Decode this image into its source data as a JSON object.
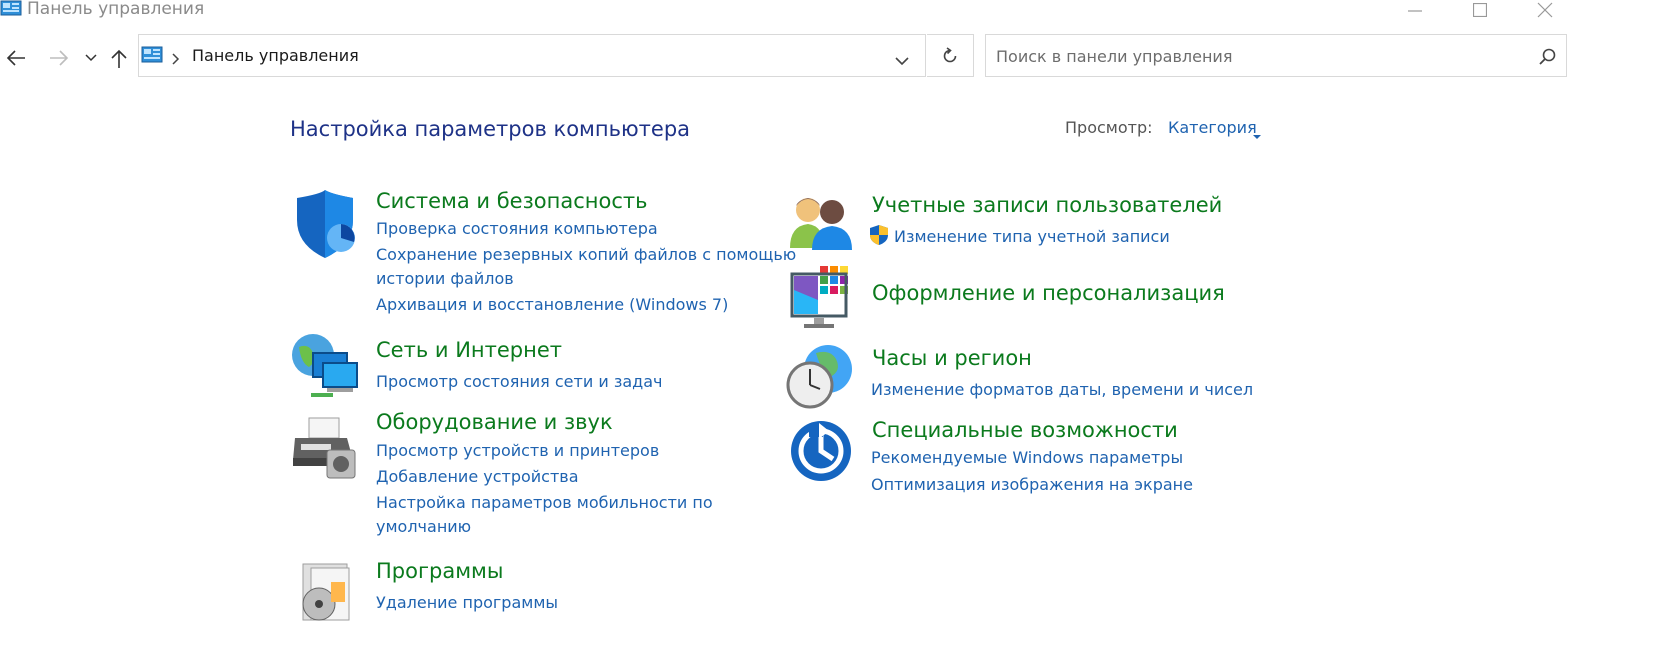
{
  "window": {
    "title": "Панель управления"
  },
  "address_bar": {
    "path_item": "Панель управления"
  },
  "search": {
    "placeholder": "Поиск в панели управления"
  },
  "main": {
    "heading": "Настройка параметров компьютера",
    "view_label": "Просмотр:",
    "view_value": "Категория"
  },
  "categories": [
    {
      "title": "Система и безопасность",
      "icon": "shield-icon",
      "links": [
        "Проверка состояния компьютера",
        "Сохранение резервных копий файлов с помощью",
        "истории файлов",
        "Архивация и восстановление (Windows 7)"
      ]
    },
    {
      "title": "Сеть и Интернет",
      "icon": "network-icon",
      "links": [
        "Просмотр состояния сети и задач"
      ]
    },
    {
      "title": "Оборудование и звук",
      "icon": "printer-icon",
      "links": [
        "Просмотр устройств и принтеров",
        "Добавление устройства",
        "Настройка параметров мобильности по",
        "умолчанию"
      ]
    },
    {
      "title": "Программы",
      "icon": "programs-icon",
      "links": [
        "Удаление программы"
      ]
    },
    {
      "title": "Учетные записи пользователей",
      "icon": "users-icon",
      "links": [
        "Изменение типа учетной записи"
      ]
    },
    {
      "title": "Оформление и персонализация",
      "icon": "display-icon",
      "links": []
    },
    {
      "title": "Часы и регион",
      "icon": "clock-globe-icon",
      "links": [
        "Изменение форматов даты, времени и чисел"
      ]
    },
    {
      "title": "Специальные возможности",
      "icon": "accessibility-icon",
      "links": [
        "Рекомендуемые Windows параметры",
        "Оптимизация изображения на экране"
      ]
    }
  ]
}
